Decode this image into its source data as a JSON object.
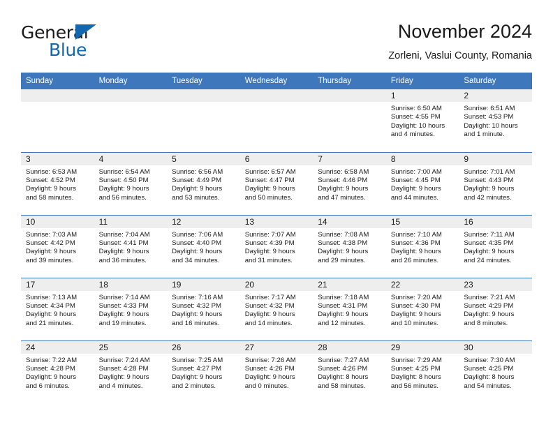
{
  "brand": {
    "name_top": "General",
    "name_bottom": "Blue",
    "accent_color": "#1367ae",
    "triangle_icon": "triangle-icon"
  },
  "header": {
    "title": "November 2024",
    "subtitle": "Zorleni, Vaslui County, Romania"
  },
  "theme": {
    "header_blue": "#3f77bd",
    "daynum_bg": "#eeeeee",
    "text": "#1a1a1a"
  },
  "calendar": {
    "weekday_headers": [
      "Sunday",
      "Monday",
      "Tuesday",
      "Wednesday",
      "Thursday",
      "Friday",
      "Saturday"
    ],
    "labels": {
      "sunrise": "Sunrise:",
      "sunset": "Sunset:",
      "daylight": "Daylight:"
    },
    "weeks": [
      [
        {
          "day": "",
          "sunrise": "",
          "sunset": "",
          "daylight_1": "",
          "daylight_2": ""
        },
        {
          "day": "",
          "sunrise": "",
          "sunset": "",
          "daylight_1": "",
          "daylight_2": ""
        },
        {
          "day": "",
          "sunrise": "",
          "sunset": "",
          "daylight_1": "",
          "daylight_2": ""
        },
        {
          "day": "",
          "sunrise": "",
          "sunset": "",
          "daylight_1": "",
          "daylight_2": ""
        },
        {
          "day": "",
          "sunrise": "",
          "sunset": "",
          "daylight_1": "",
          "daylight_2": ""
        },
        {
          "day": "1",
          "sunrise": "Sunrise: 6:50 AM",
          "sunset": "Sunset: 4:55 PM",
          "daylight_1": "Daylight: 10 hours",
          "daylight_2": "and 4 minutes."
        },
        {
          "day": "2",
          "sunrise": "Sunrise: 6:51 AM",
          "sunset": "Sunset: 4:53 PM",
          "daylight_1": "Daylight: 10 hours",
          "daylight_2": "and 1 minute."
        }
      ],
      [
        {
          "day": "3",
          "sunrise": "Sunrise: 6:53 AM",
          "sunset": "Sunset: 4:52 PM",
          "daylight_1": "Daylight: 9 hours",
          "daylight_2": "and 58 minutes."
        },
        {
          "day": "4",
          "sunrise": "Sunrise: 6:54 AM",
          "sunset": "Sunset: 4:50 PM",
          "daylight_1": "Daylight: 9 hours",
          "daylight_2": "and 56 minutes."
        },
        {
          "day": "5",
          "sunrise": "Sunrise: 6:56 AM",
          "sunset": "Sunset: 4:49 PM",
          "daylight_1": "Daylight: 9 hours",
          "daylight_2": "and 53 minutes."
        },
        {
          "day": "6",
          "sunrise": "Sunrise: 6:57 AM",
          "sunset": "Sunset: 4:47 PM",
          "daylight_1": "Daylight: 9 hours",
          "daylight_2": "and 50 minutes."
        },
        {
          "day": "7",
          "sunrise": "Sunrise: 6:58 AM",
          "sunset": "Sunset: 4:46 PM",
          "daylight_1": "Daylight: 9 hours",
          "daylight_2": "and 47 minutes."
        },
        {
          "day": "8",
          "sunrise": "Sunrise: 7:00 AM",
          "sunset": "Sunset: 4:45 PM",
          "daylight_1": "Daylight: 9 hours",
          "daylight_2": "and 44 minutes."
        },
        {
          "day": "9",
          "sunrise": "Sunrise: 7:01 AM",
          "sunset": "Sunset: 4:43 PM",
          "daylight_1": "Daylight: 9 hours",
          "daylight_2": "and 42 minutes."
        }
      ],
      [
        {
          "day": "10",
          "sunrise": "Sunrise: 7:03 AM",
          "sunset": "Sunset: 4:42 PM",
          "daylight_1": "Daylight: 9 hours",
          "daylight_2": "and 39 minutes."
        },
        {
          "day": "11",
          "sunrise": "Sunrise: 7:04 AM",
          "sunset": "Sunset: 4:41 PM",
          "daylight_1": "Daylight: 9 hours",
          "daylight_2": "and 36 minutes."
        },
        {
          "day": "12",
          "sunrise": "Sunrise: 7:06 AM",
          "sunset": "Sunset: 4:40 PM",
          "daylight_1": "Daylight: 9 hours",
          "daylight_2": "and 34 minutes."
        },
        {
          "day": "13",
          "sunrise": "Sunrise: 7:07 AM",
          "sunset": "Sunset: 4:39 PM",
          "daylight_1": "Daylight: 9 hours",
          "daylight_2": "and 31 minutes."
        },
        {
          "day": "14",
          "sunrise": "Sunrise: 7:08 AM",
          "sunset": "Sunset: 4:38 PM",
          "daylight_1": "Daylight: 9 hours",
          "daylight_2": "and 29 minutes."
        },
        {
          "day": "15",
          "sunrise": "Sunrise: 7:10 AM",
          "sunset": "Sunset: 4:36 PM",
          "daylight_1": "Daylight: 9 hours",
          "daylight_2": "and 26 minutes."
        },
        {
          "day": "16",
          "sunrise": "Sunrise: 7:11 AM",
          "sunset": "Sunset: 4:35 PM",
          "daylight_1": "Daylight: 9 hours",
          "daylight_2": "and 24 minutes."
        }
      ],
      [
        {
          "day": "17",
          "sunrise": "Sunrise: 7:13 AM",
          "sunset": "Sunset: 4:34 PM",
          "daylight_1": "Daylight: 9 hours",
          "daylight_2": "and 21 minutes."
        },
        {
          "day": "18",
          "sunrise": "Sunrise: 7:14 AM",
          "sunset": "Sunset: 4:33 PM",
          "daylight_1": "Daylight: 9 hours",
          "daylight_2": "and 19 minutes."
        },
        {
          "day": "19",
          "sunrise": "Sunrise: 7:16 AM",
          "sunset": "Sunset: 4:32 PM",
          "daylight_1": "Daylight: 9 hours",
          "daylight_2": "and 16 minutes."
        },
        {
          "day": "20",
          "sunrise": "Sunrise: 7:17 AM",
          "sunset": "Sunset: 4:32 PM",
          "daylight_1": "Daylight: 9 hours",
          "daylight_2": "and 14 minutes."
        },
        {
          "day": "21",
          "sunrise": "Sunrise: 7:18 AM",
          "sunset": "Sunset: 4:31 PM",
          "daylight_1": "Daylight: 9 hours",
          "daylight_2": "and 12 minutes."
        },
        {
          "day": "22",
          "sunrise": "Sunrise: 7:20 AM",
          "sunset": "Sunset: 4:30 PM",
          "daylight_1": "Daylight: 9 hours",
          "daylight_2": "and 10 minutes."
        },
        {
          "day": "23",
          "sunrise": "Sunrise: 7:21 AM",
          "sunset": "Sunset: 4:29 PM",
          "daylight_1": "Daylight: 9 hours",
          "daylight_2": "and 8 minutes."
        }
      ],
      [
        {
          "day": "24",
          "sunrise": "Sunrise: 7:22 AM",
          "sunset": "Sunset: 4:28 PM",
          "daylight_1": "Daylight: 9 hours",
          "daylight_2": "and 6 minutes."
        },
        {
          "day": "25",
          "sunrise": "Sunrise: 7:24 AM",
          "sunset": "Sunset: 4:28 PM",
          "daylight_1": "Daylight: 9 hours",
          "daylight_2": "and 4 minutes."
        },
        {
          "day": "26",
          "sunrise": "Sunrise: 7:25 AM",
          "sunset": "Sunset: 4:27 PM",
          "daylight_1": "Daylight: 9 hours",
          "daylight_2": "and 2 minutes."
        },
        {
          "day": "27",
          "sunrise": "Sunrise: 7:26 AM",
          "sunset": "Sunset: 4:26 PM",
          "daylight_1": "Daylight: 9 hours",
          "daylight_2": "and 0 minutes."
        },
        {
          "day": "28",
          "sunrise": "Sunrise: 7:27 AM",
          "sunset": "Sunset: 4:26 PM",
          "daylight_1": "Daylight: 8 hours",
          "daylight_2": "and 58 minutes."
        },
        {
          "day": "29",
          "sunrise": "Sunrise: 7:29 AM",
          "sunset": "Sunset: 4:25 PM",
          "daylight_1": "Daylight: 8 hours",
          "daylight_2": "and 56 minutes."
        },
        {
          "day": "30",
          "sunrise": "Sunrise: 7:30 AM",
          "sunset": "Sunset: 4:25 PM",
          "daylight_1": "Daylight: 8 hours",
          "daylight_2": "and 54 minutes."
        }
      ]
    ]
  }
}
